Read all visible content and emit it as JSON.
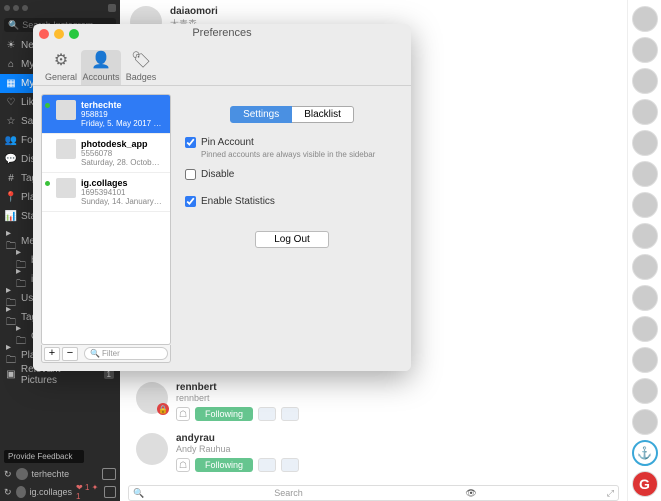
{
  "sidebar": {
    "search_placeholder": "Search Instagram",
    "items": [
      {
        "icon": "☀",
        "label": "New…"
      },
      {
        "icon": "⌂",
        "label": "My …"
      },
      {
        "icon": "▦",
        "label": "My …"
      },
      {
        "icon": "♡",
        "label": "Like…"
      },
      {
        "icon": "☆",
        "label": "Sav…"
      },
      {
        "icon": "👥",
        "label": "Foll…"
      },
      {
        "icon": "💬",
        "label": "Disc…"
      },
      {
        "icon": "#",
        "label": "Tag…"
      },
      {
        "icon": "📍",
        "label": "Plac…"
      },
      {
        "icon": "📊",
        "label": "Stat…"
      }
    ],
    "folders": [
      {
        "label": "Med…"
      },
      {
        "label": "b…"
      },
      {
        "label": "in…"
      },
      {
        "label": "Use…"
      },
      {
        "label": "Tag…"
      },
      {
        "label": "C…"
      },
      {
        "label": "Pla…"
      }
    ],
    "relevant": {
      "label": "Relevant Pictures",
      "count": "1"
    },
    "feedback": "Provide Feedback",
    "bottom_accounts": [
      {
        "name": "terhechte",
        "hearts": ""
      },
      {
        "name": "ig.collages",
        "hearts": "❤ 1  ✦ 1"
      }
    ]
  },
  "main": {
    "top_user": {
      "name": "daiaomori",
      "sub": "大青森"
    },
    "users": [
      {
        "name": "rennbert",
        "sub": "rennbert",
        "button": "Following",
        "locked": true
      },
      {
        "name": "andyrau",
        "sub": "Andy Rauhua",
        "button": "Following",
        "locked": false
      }
    ],
    "search_placeholder": "Search"
  },
  "modal": {
    "title": "Preferences",
    "tabs": [
      {
        "icon": "⚙",
        "label": "General"
      },
      {
        "icon": "👤",
        "label": "Accounts"
      },
      {
        "icon": "🏷",
        "label": "Badges"
      }
    ],
    "accounts": [
      {
        "name": "terhechte",
        "id": "958819",
        "date": "Friday, 5. May 2017 at 19:14…",
        "online": true
      },
      {
        "name": "photodesk_app",
        "id": "5556078",
        "date": "Saturday, 28. October 2017…",
        "online": false
      },
      {
        "name": "ig.collages",
        "id": "1695394101",
        "date": "Sunday, 14. January 2018 at…",
        "online": true
      }
    ],
    "filter_placeholder": "Filter",
    "segmented": [
      "Settings",
      "Blacklist"
    ],
    "checks": {
      "pin": {
        "label": "Pin Account",
        "hint": "Pinned accounts are always visible in the sidebar",
        "checked": true
      },
      "disable": {
        "label": "Disable",
        "checked": false
      },
      "stats": {
        "label": "Enable Statistics",
        "checked": true
      }
    },
    "logout": "Log Out"
  }
}
